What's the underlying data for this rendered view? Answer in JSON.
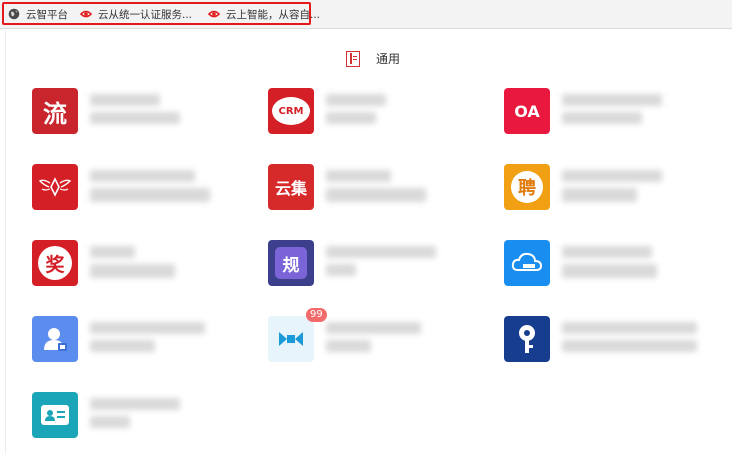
{
  "bookmarks": [
    {
      "label": "云智平台",
      "icon": "globe-icon"
    },
    {
      "label": "云从统一认证服务...",
      "icon": "eye-logo-icon"
    },
    {
      "label": "云上智能，从容自...",
      "icon": "eye-logo-icon"
    }
  ],
  "section": {
    "title": "通用",
    "icon": "document-icon"
  },
  "apps": [
    {
      "icon_text": "流",
      "icon_name": "workflow-app-icon",
      "color": "#c8252c"
    },
    {
      "icon_text": "CRM",
      "icon_name": "crm-app-icon",
      "color": "#d41f26"
    },
    {
      "icon_text": "OA",
      "icon_name": "oa-app-icon",
      "color": "#e8183f"
    },
    {
      "icon_text": "",
      "icon_name": "wings-emblem-app-icon",
      "color": "#d41f26"
    },
    {
      "icon_text": "云集",
      "icon_name": "yunji-app-icon",
      "color": "#d62a2a"
    },
    {
      "icon_text": "聘",
      "icon_name": "recruit-app-icon",
      "color": "#f0a012"
    },
    {
      "icon_text": "奖",
      "icon_name": "award-app-icon",
      "color": "#d41f26"
    },
    {
      "icon_text": "规",
      "icon_name": "rules-app-icon",
      "color": "#3b3f8c"
    },
    {
      "icon_text": "",
      "icon_name": "cloud-upload-app-icon",
      "color": "#1a8ef0"
    },
    {
      "icon_text": "",
      "icon_name": "user-lock-app-icon",
      "color": "#5b8def"
    },
    {
      "icon_text": "",
      "icon_name": "m-logo-app-icon",
      "color": "#e8f4fb",
      "badge": "99"
    },
    {
      "icon_text": "",
      "icon_name": "key-app-icon",
      "color": "#173d8f"
    },
    {
      "icon_text": "",
      "icon_name": "id-card-app-icon",
      "color": "#1aa6b8"
    }
  ]
}
